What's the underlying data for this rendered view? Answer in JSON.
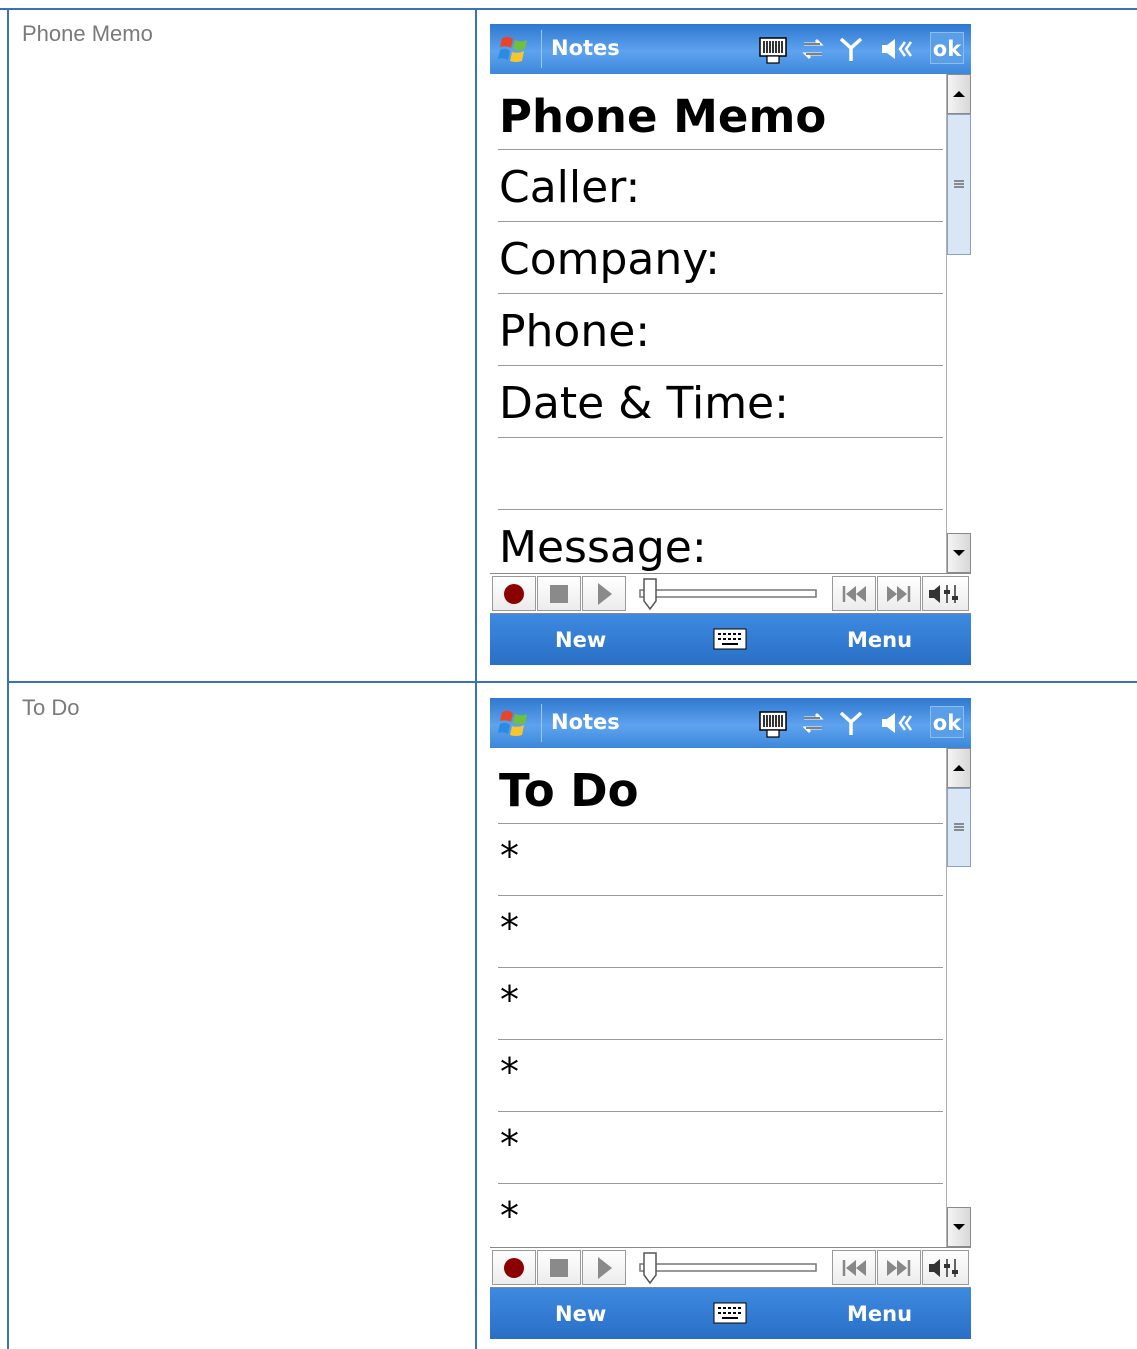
{
  "rows": [
    {
      "label": "Phone Memo",
      "device": {
        "app_title": "Notes",
        "ok_label": "ok",
        "note_title": "Phone Memo",
        "lines": [
          "Caller:",
          "Company:",
          "Phone:",
          "Date & Time:",
          "",
          "Message:"
        ],
        "softkeys": {
          "left": "New",
          "right": "Menu"
        }
      }
    },
    {
      "label": "To Do",
      "device": {
        "app_title": "Notes",
        "ok_label": "ok",
        "note_title": "To Do",
        "lines": [
          "*",
          "*",
          "*",
          "*",
          "*",
          "*"
        ],
        "softkeys": {
          "left": "New",
          "right": "Menu"
        }
      }
    }
  ],
  "icons": {
    "title_bar": [
      "windows-start-icon",
      "sip-barcode-icon",
      "connectivity-icon",
      "signal-icon",
      "volume-icon"
    ],
    "player": [
      "record-icon",
      "stop-icon",
      "play-icon",
      "position-slider",
      "previous-icon",
      "next-icon",
      "volume-control-icon"
    ],
    "soft_bar": [
      "keyboard-icon"
    ]
  },
  "colors": {
    "grid_line": "#3a73b4",
    "title_bar": "#4a93e6",
    "soft_bar": "#2f78cf",
    "record": "#8b0000"
  }
}
